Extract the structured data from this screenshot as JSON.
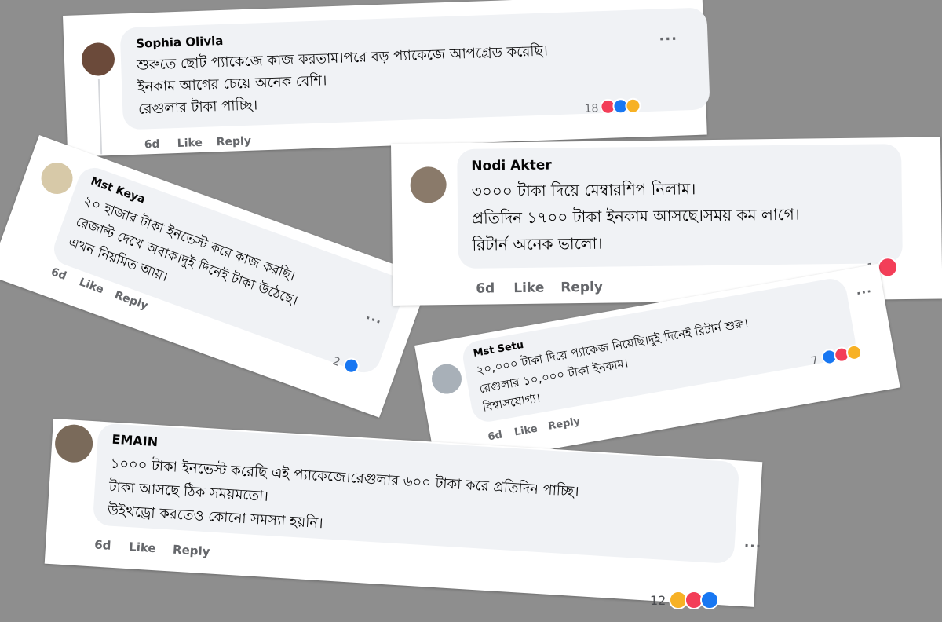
{
  "colors": {
    "background": "#8e8e8e",
    "card": "#ffffff",
    "bubble": "#f0f2f5",
    "text": "#050505",
    "meta": "#65676b",
    "like_blue": "#1877f2",
    "love_red": "#f33e58",
    "care_yellow": "#f7b125"
  },
  "comments": [
    {
      "author": "Sophia Olivia",
      "lines": [
        "শুরুতে ছোট প্যাকেজে কাজ করতাম।পরে বড় প্যাকেজে আপগ্রেড করেছি।",
        "ইনকাম আগের চেয়ে অনেক বেশি।",
        "রেগুলার টাকা পাচ্ছি।"
      ],
      "time": "6d",
      "like_label": "Like",
      "reply_label": "Reply",
      "reaction_count": "18",
      "reactions": [
        "love-icon",
        "like-icon",
        "care-icon"
      ],
      "more": "..."
    },
    {
      "author": "Mst Keya",
      "lines": [
        "২০ হাজার টাকা ইনভেস্ট করে কাজ করছি।",
        "রেজাল্ট দেখে অবাক।দুই দিনেই টাকা উঠেছে।",
        "এখন নিয়মিত আয়।"
      ],
      "time": "6d",
      "like_label": "Like",
      "reply_label": "Reply",
      "reaction_count": "2",
      "reactions": [
        "like-icon"
      ],
      "more": "..."
    },
    {
      "author": "Nodi Akter",
      "lines": [
        "৩০০০ টাকা দিয়ে মেম্বারশিপ নিলাম।",
        "প্রতিদিন ১৭০০ টাকা ইনকাম আসছে।সময় কম লাগে।",
        "রিটার্ন অনেক ভালো।"
      ],
      "time": "6d",
      "like_label": "Like",
      "reply_label": "Reply",
      "reaction_count": "1",
      "reactions": [
        "love-icon"
      ],
      "more": "..."
    },
    {
      "author": "Mst Setu",
      "lines": [
        "২০,০০০ টাকা দিয়ে প্যাকেজ নিয়েছি।দুই দিনেই রিটার্ন শুরু।",
        "রেগুলার ১০,০০০ টাকা ইনকাম।",
        "বিশ্বাসযোগ্য।"
      ],
      "time": "6d",
      "like_label": "Like",
      "reply_label": "Reply",
      "reaction_count": "7",
      "reactions": [
        "like-icon",
        "love-icon",
        "haha-icon"
      ],
      "more": "..."
    },
    {
      "author": "EMAIN",
      "lines": [
        "১০০০ টাকা ইনভেস্ট করেছি এই প্যাকেজে।রেগুলার ৬০০ টাকা করে প্রতিদিন পাচ্ছি।",
        "টাকা আসছে ঠিক সময়মতো।",
        "উইথড্রো করতেও কোনো সমস্যা হয়নি।"
      ],
      "time": "6d",
      "like_label": "Like",
      "reply_label": "Reply",
      "reaction_count": "12",
      "reactions": [
        "haha-icon",
        "love-icon",
        "like-icon"
      ],
      "more": "..."
    }
  ]
}
